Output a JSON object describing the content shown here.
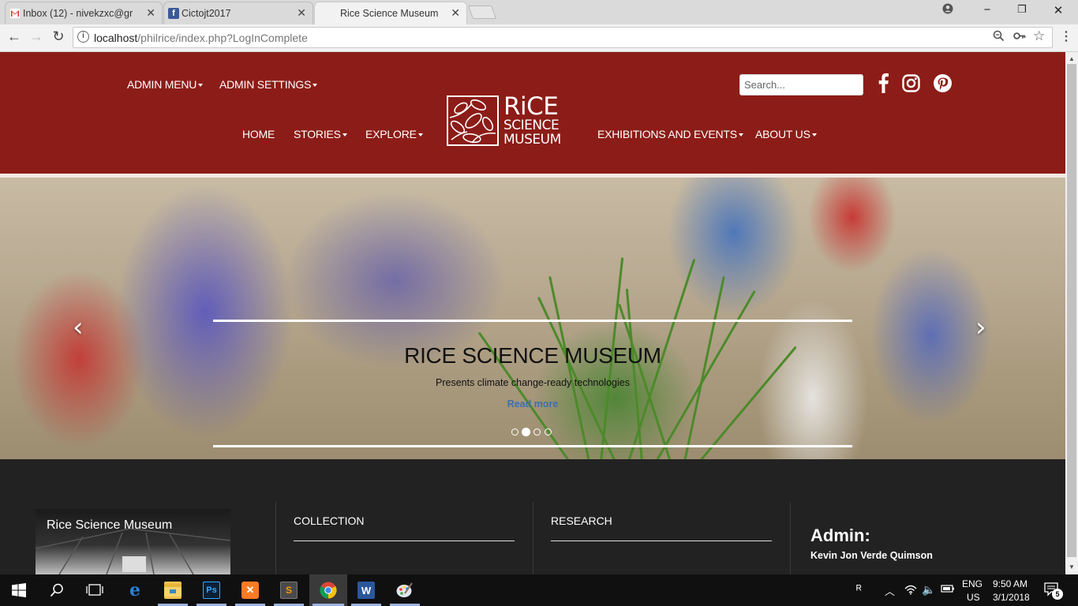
{
  "browser": {
    "tabs": [
      {
        "label": "Inbox (12) - nivekzxc@gr",
        "icon": "gmail-icon",
        "color": "#d93025"
      },
      {
        "label": "Cictojt2017",
        "icon": "facebook-icon",
        "color": "#3b5998"
      },
      {
        "label": "Rice Science Museum",
        "icon": "none",
        "color": ""
      }
    ],
    "url_host": "localhost",
    "url_path": "/philrice/index.php?LogInComplete",
    "window_controls": {
      "minimize": "−",
      "restore": "❐",
      "close": "✕"
    }
  },
  "header": {
    "top_nav": [
      {
        "label": "ADMIN MENU",
        "dropdown": true
      },
      {
        "label": "ADMIN SETTINGS",
        "dropdown": true
      }
    ],
    "main_nav_left": [
      {
        "label": "HOME",
        "dropdown": false
      },
      {
        "label": "STORIES",
        "dropdown": true
      },
      {
        "label": "EXPLORE",
        "dropdown": true
      }
    ],
    "main_nav_right": [
      {
        "label": "EXHIBITIONS AND EVENTS",
        "dropdown": true
      },
      {
        "label": "ABOUT US",
        "dropdown": true
      }
    ],
    "search_placeholder": "Search...",
    "logo_lines": [
      "RiCE",
      "SCIENCE",
      "MUSEUM"
    ],
    "social": [
      "facebook-icon",
      "instagram-icon",
      "pinterest-icon"
    ],
    "brand_color": "#8c1c17"
  },
  "carousel": {
    "title": "RICE SCIENCE MUSEUM",
    "subtitle": "Presents climate change-ready technologies",
    "read_more": "Read more",
    "slide_count": 4,
    "active_slide": 2,
    "prev": "‹",
    "next": "›"
  },
  "footer": {
    "video_title": "Rice Science Museum",
    "col_collection": "COLLECTION",
    "col_research": "RESEARCH",
    "admin_label": "Admin:",
    "admin_name": "Kevin Jon Verde Quimson"
  },
  "taskbar": {
    "apps": [
      "start-icon",
      "search-icon",
      "task-view-icon",
      "edge-icon",
      "file-explorer-icon",
      "photoshop-icon",
      "xampp-icon",
      "sublime-icon",
      "chrome-icon",
      "word-icon",
      "paint-icon"
    ],
    "lang_top": "ENG",
    "lang_bottom": "US",
    "time": "9:50 AM",
    "date": "3/1/2018",
    "notifications": "5"
  }
}
